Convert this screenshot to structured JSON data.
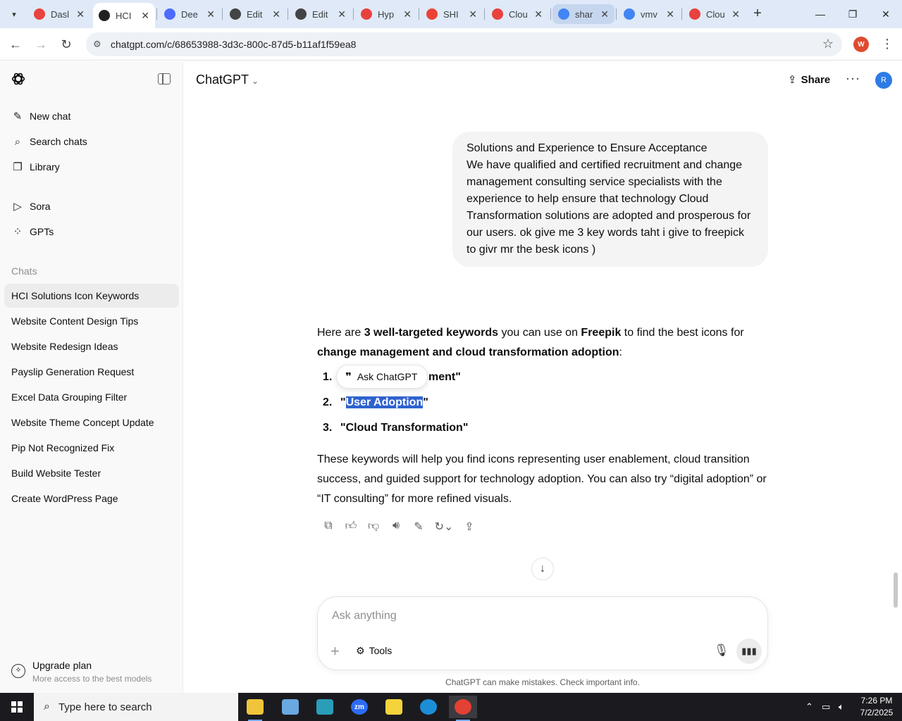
{
  "browser": {
    "tabs": [
      {
        "title": "Dasl",
        "favicon_color": "#e8423f"
      },
      {
        "title": "HCI",
        "favicon_color": "#202123",
        "active": true
      },
      {
        "title": "Dee",
        "favicon_color": "#4d6bfe"
      },
      {
        "title": "Edit",
        "favicon_color": "#444444"
      },
      {
        "title": "Edit",
        "favicon_color": "#444444"
      },
      {
        "title": "Hyp",
        "favicon_color": "#e8423f"
      },
      {
        "title": "SHI",
        "favicon_color": "#ea4335"
      },
      {
        "title": "Clou",
        "favicon_color": "#e8423f"
      },
      {
        "title": "shar",
        "favicon_color": "#4285f4"
      },
      {
        "title": "vmv",
        "favicon_color": "#4285f4"
      },
      {
        "title": "Clou",
        "favicon_color": "#e8423f"
      }
    ],
    "new_tab_label": "+",
    "url": "chatgpt.com/c/68653988-3d3c-800c-87d5-b11af1f59ea8",
    "profile_initial": "W"
  },
  "sidebar": {
    "nav": [
      {
        "label": "New chat",
        "icon": "new-chat-icon"
      },
      {
        "label": "Search chats",
        "icon": "search-icon"
      },
      {
        "label": "Library",
        "icon": "library-icon"
      },
      {
        "label": "Sora",
        "icon": "play-icon"
      },
      {
        "label": "GPTs",
        "icon": "grid-icon"
      }
    ],
    "chats_title": "Chats",
    "chats": [
      {
        "label": "HCI Solutions Icon Keywords",
        "active": true
      },
      {
        "label": "Website Content Design Tips"
      },
      {
        "label": "Website Redesign Ideas"
      },
      {
        "label": "Payslip Generation Request"
      },
      {
        "label": "Excel Data Grouping Filter"
      },
      {
        "label": "Website Theme Concept Update"
      },
      {
        "label": "Pip Not Recognized Fix"
      },
      {
        "label": "Build Website Tester"
      },
      {
        "label": "Create WordPress Page"
      }
    ],
    "upgrade": {
      "title": "Upgrade plan",
      "subtitle": "More access to the best models"
    }
  },
  "header": {
    "model": "ChatGPT",
    "share_label": "Share",
    "avatar_initial": "R"
  },
  "conversation": {
    "user_message_lines": [
      "Solutions and Experience to Ensure Acceptance",
      "We have qualified and certified recruitment and change management consulting service specialists with the experience to help ensure that technology Cloud Transformation solutions are adopted and prosperous for our users. ok give me 3 key words taht i give to freepick to givr mr the besk icons )"
    ],
    "answer": {
      "intro_1": "Here are ",
      "intro_bold_1": "3 well-targeted keywords",
      "intro_2": " you can use on ",
      "intro_bold_2": "Freepik",
      "intro_3": " to find the best icons for ",
      "intro_bold_3": "change management and cloud transformation adoption",
      "intro_4": ":",
      "keywords": [
        {
          "num": "1.",
          "pre": "",
          "text": "ment\""
        },
        {
          "num": "2.",
          "pre": "\"",
          "text": "User Adoption",
          "post": "\""
        },
        {
          "num": "3.",
          "pre": "",
          "text": "\"Cloud Transformation\""
        }
      ],
      "closing": "These keywords will help you find icons representing user enablement, cloud transition success, and guided support for technology adoption. You can also try “digital adoption” or “IT consulting” for more refined visuals."
    },
    "ask_popup_label": "Ask ChatGPT"
  },
  "composer": {
    "placeholder": "Ask anything",
    "tools_label": "Tools",
    "disclaimer": "ChatGPT can make mistakes. Check important info."
  },
  "taskbar": {
    "search_placeholder": "Type here to search",
    "time": "7:26 PM",
    "date": "7/2/2025"
  }
}
